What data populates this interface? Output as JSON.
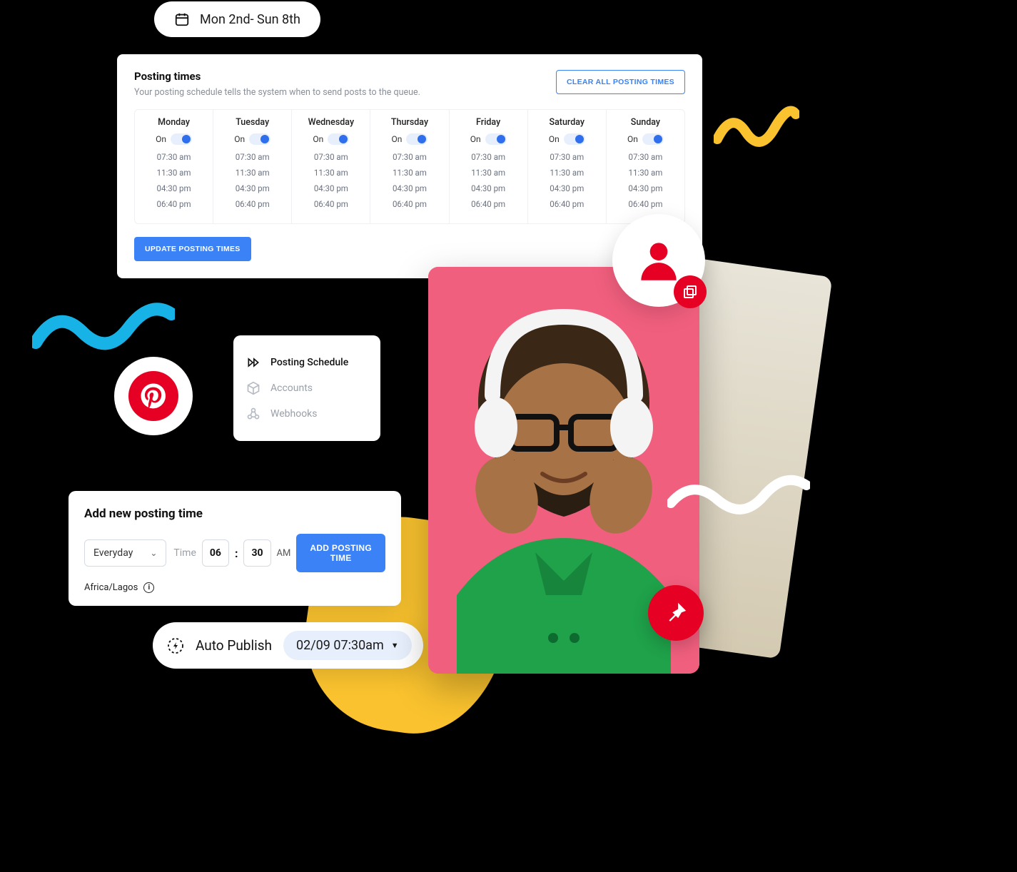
{
  "date_range": "Mon 2nd- Sun 8th",
  "posting_times": {
    "title": "Posting times",
    "subtitle": "Your posting schedule tells the system when to send posts to the queue.",
    "clear_button": "CLEAR ALL POSTING TIMES",
    "update_button": "UPDATE POSTING TIMES",
    "on_label": "On",
    "days": [
      {
        "name": "Monday",
        "slots": [
          "07:30 am",
          "11:30 am",
          "04:30 pm",
          "06:40 pm"
        ]
      },
      {
        "name": "Tuesday",
        "slots": [
          "07:30 am",
          "11:30 am",
          "04:30 pm",
          "06:40 pm"
        ]
      },
      {
        "name": "Wednesday",
        "slots": [
          "07:30 am",
          "11:30 am",
          "04:30 pm",
          "06:40 pm"
        ]
      },
      {
        "name": "Thursday",
        "slots": [
          "07:30 am",
          "11:30 am",
          "04:30 pm",
          "06:40 pm"
        ]
      },
      {
        "name": "Friday",
        "slots": [
          "07:30 am",
          "11:30 am",
          "04:30 pm",
          "06:40 pm"
        ]
      },
      {
        "name": "Saturday",
        "slots": [
          "07:30 am",
          "11:30 am",
          "04:30 pm",
          "06:40 pm"
        ]
      },
      {
        "name": "Sunday",
        "slots": [
          "07:30 am",
          "11:30 am",
          "04:30 pm",
          "06:40 pm"
        ]
      }
    ]
  },
  "nav": {
    "items": [
      {
        "label": "Posting Schedule",
        "icon": "fast-forward-icon",
        "active": true
      },
      {
        "label": "Accounts",
        "icon": "cube-icon",
        "active": false
      },
      {
        "label": "Webhooks",
        "icon": "webhook-icon",
        "active": false
      }
    ]
  },
  "add_time": {
    "title": "Add new posting time",
    "frequency": "Everyday",
    "time_label": "Time",
    "hour": "06",
    "minute": "30",
    "ampm": "AM",
    "button": "ADD POSTING TIME",
    "timezone": "Africa/Lagos"
  },
  "auto_publish": {
    "label": "Auto Publish",
    "datetime": "02/09 07:30am"
  },
  "colors": {
    "primary": "#3b82f6",
    "pinterest": "#e60023",
    "yellow": "#f9c22e",
    "blue_squiggle": "#17b3e6"
  }
}
